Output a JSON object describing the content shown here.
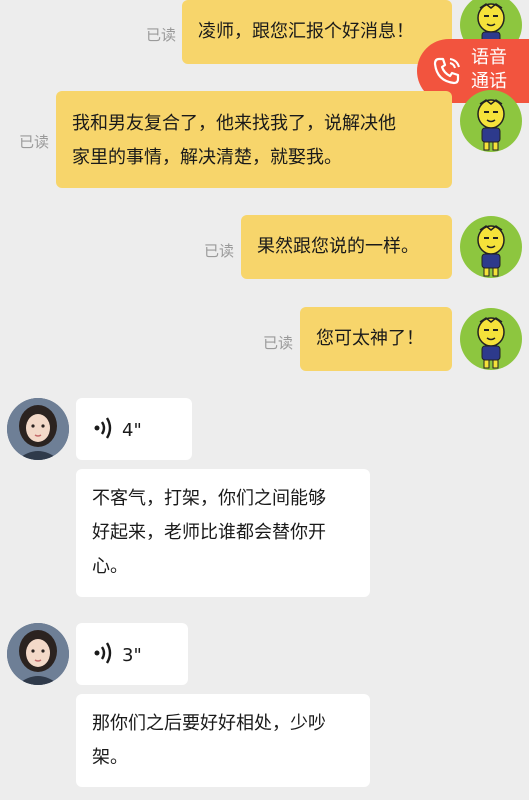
{
  "read_label": "已读",
  "call_button": {
    "label_line1": "语音",
    "label_line2": "通话",
    "icon": "phone-icon"
  },
  "messages": [
    {
      "side": "sent",
      "type": "text",
      "lines": [
        "凌师，跟您汇报个好消息！"
      ]
    },
    {
      "side": "sent",
      "type": "text",
      "lines": [
        "我和男友复合了，他来找我了，说解决他",
        "家里的事情，解决清楚，就娶我。"
      ]
    },
    {
      "side": "sent",
      "type": "text",
      "lines": [
        "果然跟您说的一样。"
      ]
    },
    {
      "side": "sent",
      "type": "text",
      "lines": [
        "您可太神了！"
      ]
    },
    {
      "side": "received",
      "type": "voice",
      "duration": "4\""
    },
    {
      "side": "received",
      "type": "text",
      "lines": [
        "不客气，打架，你们之间能够",
        "好起来，老师比谁都会替你开",
        "心。"
      ]
    },
    {
      "side": "received",
      "type": "voice",
      "duration": "3\""
    },
    {
      "side": "received",
      "type": "text",
      "lines": [
        "那你们之后要好好相处，少吵",
        "架。"
      ]
    }
  ],
  "colors": {
    "sent_bubble": "#f7d56b",
    "received_bubble": "#ffffff",
    "background": "#ededed",
    "call_button": "#f2543e"
  }
}
